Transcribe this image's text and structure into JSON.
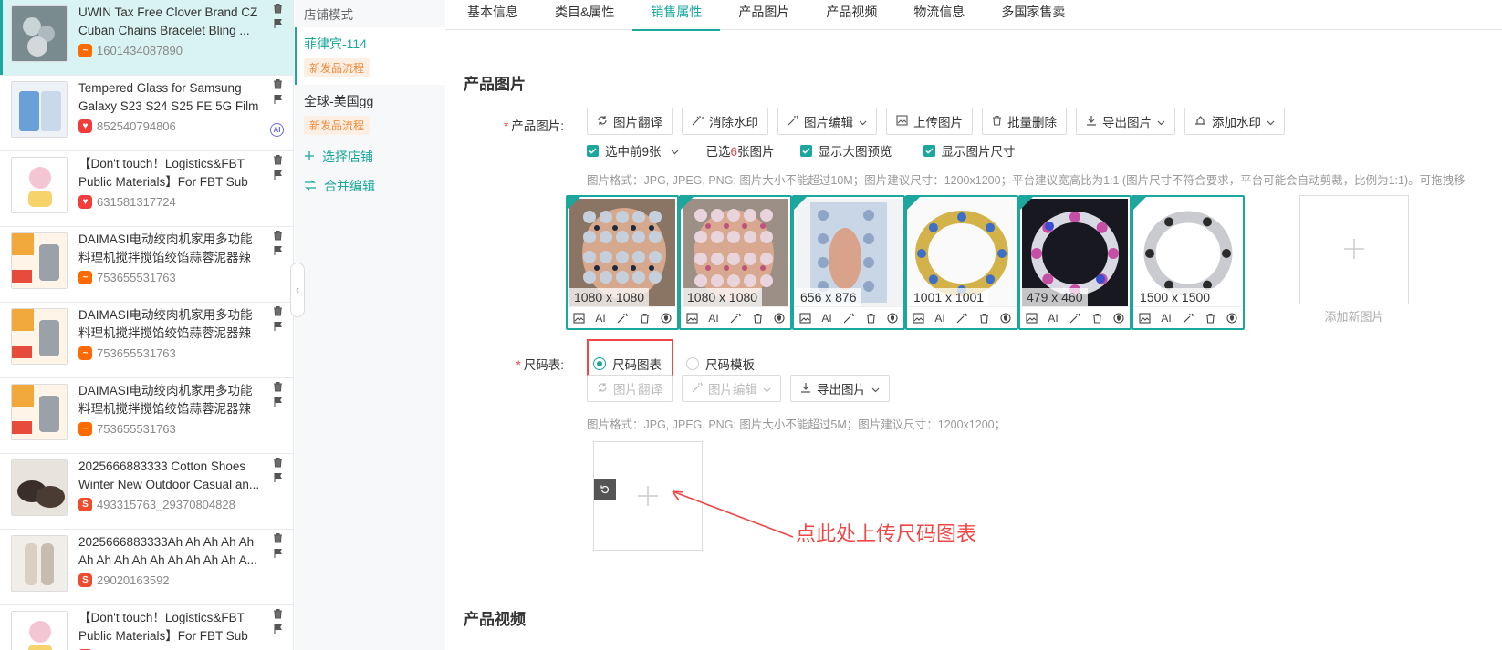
{
  "products": [
    {
      "title": "UWIN Tax Free Clover Brand CZ Cuban Chains Bracelet Bling ...",
      "id": "1601434087890",
      "platform": "ali",
      "active": true,
      "ai": false
    },
    {
      "title": "Tempered Glass for Samsung Galaxy S23 S24 S25 FE 5G Film",
      "id": "852540794806",
      "platform": "tem",
      "active": false,
      "ai": true
    },
    {
      "title": "【Don't touch！Logistics&FBT Public Materials】For FBT Sub ...",
      "id": "631581317724",
      "platform": "tem",
      "active": false,
      "ai": false
    },
    {
      "title": "DAIMASI电动绞肉机家用多功能料理机搅拌搅馅绞馅蒜蓉泥器辣椒",
      "id": "753655531763",
      "platform": "ali",
      "active": false,
      "ai": false
    },
    {
      "title": "DAIMASI电动绞肉机家用多功能料理机搅拌搅馅绞馅蒜蓉泥器辣椒",
      "id": "753655531763",
      "platform": "ali",
      "active": false,
      "ai": false
    },
    {
      "title": "DAIMASI电动绞肉机家用多功能料理机搅拌搅馅绞馅蒜蓉泥器辣椒",
      "id": "753655531763",
      "platform": "ali",
      "active": false,
      "ai": false
    },
    {
      "title": "2025666883333 Cotton Shoes Winter New Outdoor Casual an...",
      "id": "493315763_29370804828",
      "platform": "shp",
      "active": false,
      "ai": false
    },
    {
      "title": "2025666883333Ah Ah Ah Ah Ah Ah Ah Ah Ah Ah Ah Ah Ah Ah A...",
      "id": "29020163592",
      "platform": "shp",
      "active": false,
      "ai": false
    },
    {
      "title": "【Don't touch！Logistics&FBT Public Materials】For FBT Sub ...",
      "id": "",
      "platform": "tem",
      "active": false,
      "ai": false
    }
  ],
  "stores": {
    "mode_label": "店铺模式",
    "items": [
      {
        "name": "菲律宾-114",
        "tag": "新发品流程",
        "active": true
      },
      {
        "name": "全球-美国gg",
        "tag": "新发品流程",
        "active": false
      }
    ],
    "select_store": "选择店铺",
    "merge_edit": "合并编辑"
  },
  "tabs": [
    "基本信息",
    "类目&属性",
    "销售属性",
    "产品图片",
    "产品视频",
    "物流信息",
    "多国家售卖"
  ],
  "active_tab": 2,
  "product_images": {
    "section_title": "产品图片",
    "field_label": "产品图片:",
    "buttons": [
      "图片翻译",
      "消除水印",
      "图片编辑",
      "上传图片",
      "批量删除",
      "导出图片",
      "添加水印"
    ],
    "select_first": "选中前9张",
    "selected_prefix": "已选",
    "selected_count": "6",
    "selected_suffix": "张图片",
    "show_large_preview": "显示大图预览",
    "show_image_size": "显示图片尺寸",
    "hint": "图片格式：JPG, JPEG, PNG; 图片大小不能超过10M；图片建议尺寸：1200x1200；平台建议宽高比为1:1 (图片尺寸不符合要求，平台可能会自动剪裁，比例为1:1)。可拖拽移",
    "images": [
      {
        "dims": "1080 x 1080",
        "style": "hand-blue"
      },
      {
        "dims": "1080 x 1080",
        "style": "hand-pink"
      },
      {
        "dims": "656 x 876",
        "style": "bag"
      },
      {
        "dims": "1001 x 1001",
        "style": "gold"
      },
      {
        "dims": "479 x 460",
        "style": "dark"
      },
      {
        "dims": "1500 x 1500",
        "style": "silver"
      }
    ],
    "tool_ai": "AI",
    "add_new": "添加新图片"
  },
  "size_chart": {
    "field_label": "尺码表:",
    "option_chart": "尺码图表",
    "option_template": "尺码模板",
    "buttons": [
      "图片翻译",
      "图片编辑",
      "导出图片"
    ],
    "hint": "图片格式：JPG, JPEG, PNG; 图片大小不能超过5M；图片建议尺寸：1200x1200；",
    "callout": "点此处上传尺码图表"
  },
  "video_section": {
    "title": "产品视频"
  },
  "colors": {
    "accent": "#1ba79d",
    "annotation": "#f04646"
  }
}
